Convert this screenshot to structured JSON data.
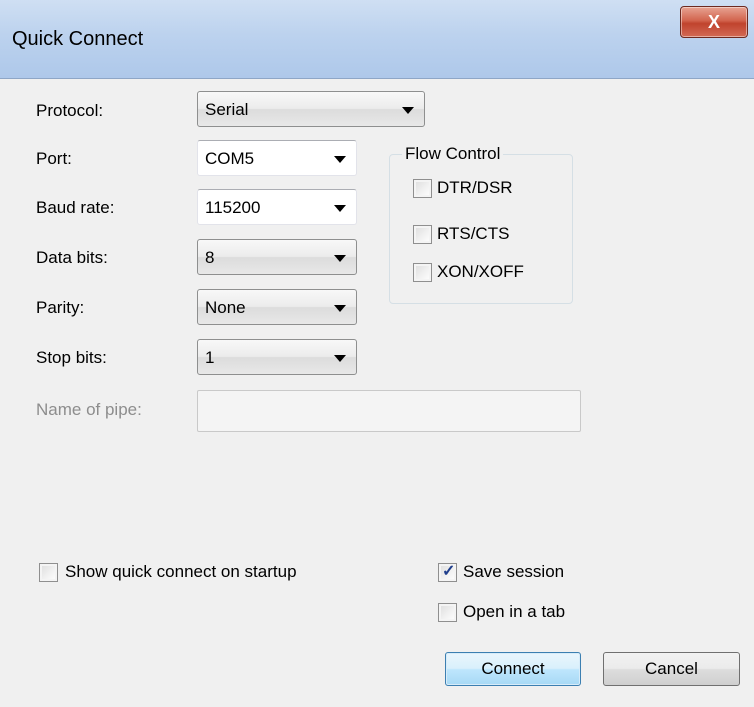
{
  "window": {
    "title": "Quick Connect",
    "close_glyph": "X"
  },
  "form": {
    "protocol": {
      "label": "Protocol:",
      "value": "Serial"
    },
    "port": {
      "label": "Port:",
      "value": "COM5"
    },
    "baud_rate": {
      "label": "Baud rate:",
      "value": "115200"
    },
    "data_bits": {
      "label": "Data bits:",
      "value": "8"
    },
    "parity": {
      "label": "Parity:",
      "value": "None"
    },
    "stop_bits": {
      "label": "Stop bits:",
      "value": "1"
    },
    "name_of_pipe": {
      "label": "Name of pipe:",
      "value": ""
    }
  },
  "flow_control": {
    "legend": "Flow Control",
    "options": [
      {
        "label": "DTR/DSR",
        "checked": false
      },
      {
        "label": "RTS/CTS",
        "checked": false
      },
      {
        "label": "XON/XOFF",
        "checked": false
      }
    ]
  },
  "options": {
    "show_on_startup": {
      "label": "Show quick connect on startup",
      "checked": false
    },
    "save_session": {
      "label": "Save session",
      "checked": true
    },
    "open_in_tab": {
      "label": "Open in a tab",
      "checked": false
    }
  },
  "buttons": {
    "connect": "Connect",
    "cancel": "Cancel"
  },
  "icons": {
    "dropdown": "chevron-down-icon",
    "close": "close-icon",
    "check": "check-icon"
  }
}
